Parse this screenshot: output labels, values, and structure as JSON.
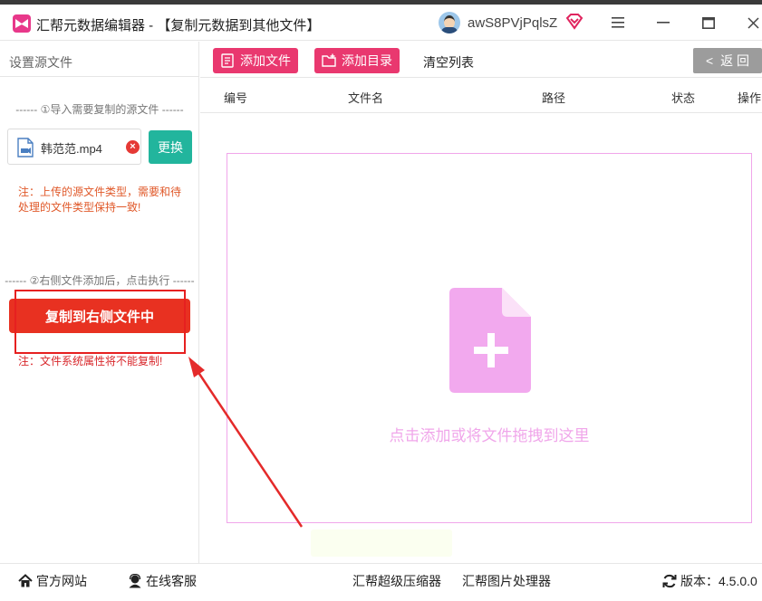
{
  "window": {
    "title": "汇帮元数据编辑器 - 【复制元数据到其他文件】",
    "user_name": "awS8PVjPqlsZ",
    "colors": {
      "accent": "#e9386f",
      "primary_red": "#e83121",
      "teal": "#22b59d",
      "drop_zone": "#f0a6ea"
    }
  },
  "sidebar": {
    "title": "设置源文件",
    "step1_label": "------ ①导入需要复制的源文件 ------",
    "file_name": "韩范范.mp4",
    "replace_label": "更换",
    "note1_line1": "注：上传的源文件类型，需要和待",
    "note1_line2": "处理的文件类型保持一致!",
    "step2_label": "------ ②右侧文件添加后，点击执行 ------",
    "copy_button": "复制到右侧文件中",
    "note2": "注：文件系统属性将不能复制!"
  },
  "toolbar": {
    "add_file": "添加文件",
    "add_dir": "添加目录",
    "clear_list": "清空列表",
    "back": "返 回"
  },
  "table": {
    "columns": [
      "编号",
      "文件名",
      "路径",
      "状态",
      "操作"
    ]
  },
  "drop_zone": {
    "hint": "点击添加或将文件拖拽到这里"
  },
  "footer": {
    "official_site": "官方网站",
    "online_service": "在线客服",
    "compressor": "汇帮超级压缩器",
    "image_tool": "汇帮图片处理器",
    "version_label": "版本：4.5.0.0"
  }
}
